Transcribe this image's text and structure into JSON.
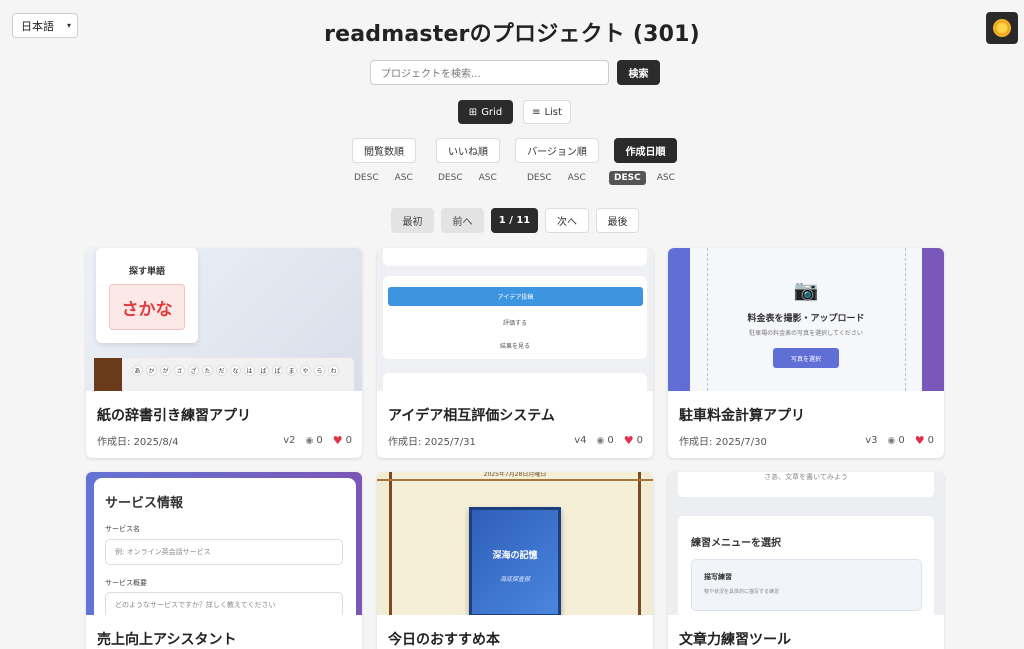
{
  "language": {
    "selected": "日本語"
  },
  "header": {
    "title": "readmasterのプロジェクト (301)"
  },
  "search": {
    "placeholder": "プロジェクトを検索...",
    "button": "検索"
  },
  "view": {
    "grid": "Grid",
    "list": "List"
  },
  "sort": {
    "options": [
      {
        "label": "閲覧数順",
        "desc": "DESC",
        "asc": "ASC"
      },
      {
        "label": "いいね順",
        "desc": "DESC",
        "asc": "ASC"
      },
      {
        "label": "バージョン順",
        "desc": "DESC",
        "asc": "ASC"
      },
      {
        "label": "作成日順",
        "desc": "DESC",
        "asc": "ASC"
      }
    ],
    "active": "作成日順",
    "active_direction": "DESC"
  },
  "pagination": {
    "first": "最初",
    "prev": "前へ",
    "current": "1 / 11",
    "next": "次へ",
    "last": "最後"
  },
  "cards": [
    {
      "title": "紙の辞書引き練習アプリ",
      "date": "作成日: 2025/8/4",
      "version": "v2",
      "views": "0",
      "likes": "0",
      "thumb": {
        "label": "探す単語",
        "word": "さかな",
        "kana": [
          "あ",
          "か",
          "が",
          "さ",
          "ざ",
          "た",
          "だ",
          "な",
          "は",
          "ば",
          "ぱ",
          "ま",
          "や",
          "ら",
          "わ"
        ]
      }
    },
    {
      "title": "アイデア相互評価システム",
      "date": "作成日: 2025/7/31",
      "version": "v4",
      "views": "0",
      "likes": "0",
      "thumb": {
        "button": "アイデア投稿",
        "link1": "評価する",
        "link2": "結果を見る"
      }
    },
    {
      "title": "駐車料金計算アプリ",
      "date": "作成日: 2025/7/30",
      "version": "v3",
      "views": "0",
      "likes": "0",
      "thumb": {
        "heading": "料金表を撮影・アップロード",
        "sub": "駐車場の料金表の写真を選択してください",
        "button": "写真を選択"
      }
    },
    {
      "title": "売上向上アシスタント",
      "thumb": {
        "heading": "サービス情報",
        "label1": "サービス名",
        "placeholder1": "例: オンライン英会話サービス",
        "label2": "サービス概要",
        "placeholder2": "どのようなサービスですか？詳しく教えてください"
      }
    },
    {
      "title": "今日のおすすめ本",
      "thumb": {
        "date": "2025年7月28日月曜日",
        "book_title": "深海の記憶",
        "book_sub": "海底探査部"
      }
    },
    {
      "title": "文章力練習ツール",
      "thumb": {
        "top": "さあ、文章を書いてみよう",
        "menu_title": "練習メニューを選択",
        "item_title": "描写練習",
        "item_sub": "物や状況を具体的に描写する練習"
      }
    }
  ],
  "colors": {
    "primary_dark": "#2b2b2b",
    "like": "#e0334a",
    "accent_blue": "#3e95df",
    "gradient_purple": "#7a56b8"
  },
  "icons": {
    "avatar": "sun-icon",
    "grid": "grid-icon",
    "list": "list-icon",
    "views": "eye-icon",
    "likes": "heart-icon"
  }
}
